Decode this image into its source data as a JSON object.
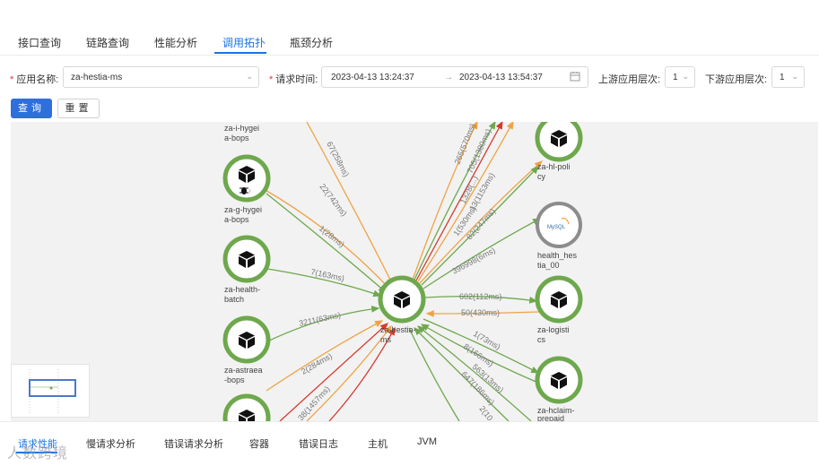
{
  "tabs": [
    {
      "label": "接口查询"
    },
    {
      "label": "链路查询"
    },
    {
      "label": "性能分析"
    },
    {
      "label": "调用拓扑"
    },
    {
      "label": "瓶颈分析"
    }
  ],
  "active_tab": "调用拓扑",
  "form": {
    "app_label": "应用名称:",
    "app_value": "za-hestia-ms",
    "time_label": "请求时间:",
    "start_time": "2023-04-13 13:24:37",
    "end_time": "2023-04-13 13:54:37",
    "range_arrow": "→",
    "upstream_label": "上游应用层次:",
    "upstream_value": "1",
    "downstream_label": "下游应用层次:",
    "downstream_value": "1",
    "query_button": "查询",
    "reset_button": "重置"
  },
  "graph": {
    "nodes": [
      {
        "id": "za-i-hygiea-bops",
        "label1": "za-i-hygei",
        "label2": "a-bops",
        "type": "service"
      },
      {
        "id": "za-g-hygiea-bops",
        "label1": "za-g-hygei",
        "label2": "a-bops",
        "type": "service-bug"
      },
      {
        "id": "za-health-batch",
        "label1": "za-health-",
        "label2": "batch",
        "type": "service"
      },
      {
        "id": "za-astraea-bops",
        "label1": "za-astraea",
        "label2": "-bops",
        "type": "service"
      },
      {
        "id": "za-hestia-ms",
        "label1": "za-hestia-",
        "label2": "ms",
        "type": "center"
      },
      {
        "id": "za-hl-policy",
        "label1": "za-hl-poli",
        "label2": "cy",
        "type": "service"
      },
      {
        "id": "health_hestia_00",
        "label1": "health_hes",
        "label2": "tia_00",
        "type": "mysql"
      },
      {
        "id": "za-logistics",
        "label1": "za-logisti",
        "label2": "cs",
        "type": "service"
      },
      {
        "id": "za-hclaim-prepaid",
        "label1": "za-hclaim-",
        "label2": "prepaid",
        "type": "service"
      },
      {
        "id": "bottom-left-node",
        "label1": "",
        "label2": "",
        "type": "service"
      }
    ],
    "edge_labels": [
      "67(258ms)",
      "22(742ms)",
      "1(28ms)",
      "7(163ms)",
      "3211(63ms)",
      "2(284ms)",
      "38(1457ms)",
      "265(570ms)",
      "705(1380ms)",
      "1328(...)",
      "13(1153ms)",
      "1(530ms)",
      "82(247ms)",
      "396998(6ms)",
      "602(112ms)",
      "50(430ms)",
      "1(73ms)",
      "8(166ms)",
      "563(13ms)",
      "647(186ms)",
      "2(10..."
    ],
    "mysql_text": "MySQL",
    "colors": {
      "green": "#6ea84d",
      "orange": "#efa346",
      "red": "#d63a2f",
      "gray": "#8c8c8c"
    }
  },
  "bottom_tabs": [
    {
      "label": "请求性能"
    },
    {
      "label": "慢请求分析"
    },
    {
      "label": "错误请求分析"
    },
    {
      "label": "容器"
    },
    {
      "label": "错误日志"
    },
    {
      "label": "主机"
    },
    {
      "label": "JVM"
    }
  ],
  "active_bottom_tab": "请求性能",
  "watermark": "人数跨境"
}
